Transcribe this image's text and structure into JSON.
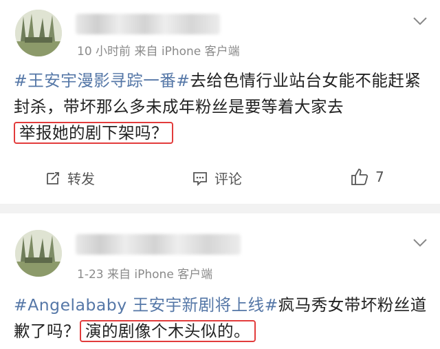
{
  "posts": [
    {
      "time_source": "10 小时前   来自 iPhone 客户端",
      "hashtag": "#王安宇漫影寻踪一番#",
      "text_pre": "去给色情行业站台女能不能赶紧封杀，带坏那么多未成年粉丝是要等着大家去",
      "text_highlight": "举报她的剧下架吗？",
      "repost_label": "转发",
      "comment_label": "评论",
      "like_count": "7"
    },
    {
      "time_source": "1-23   来自 iPhone 客户端",
      "hashtag": "#Angelababy 王安宇新剧将上线#",
      "text_pre": "疯马秀女带坏粉丝道歉了吗？",
      "text_highlight": "演的剧像个木头似的。"
    }
  ],
  "icons": {
    "avatar": "avatar-photo",
    "more": "chevron-down-icon",
    "repost": "repost-icon",
    "comment": "comment-icon",
    "like": "thumbs-up-icon"
  },
  "colors": {
    "hashtag": "#5577a7",
    "highlight_box": "#e23b3b",
    "divider": "#f2f2f2"
  }
}
